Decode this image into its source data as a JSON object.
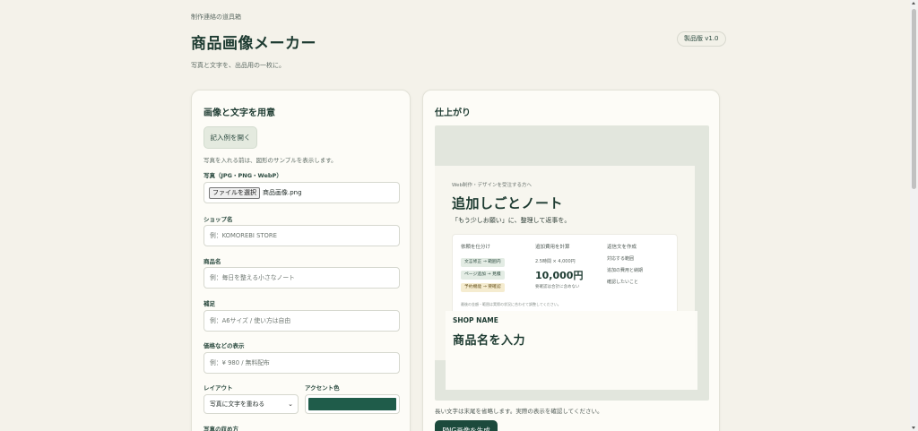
{
  "header": {
    "eyebrow": "制作連絡の道具箱",
    "title": "商品画像メーカー",
    "subtitle": "写真と文字を、出品用の一枚に。",
    "version_badge": "製品版 v1.0"
  },
  "form_panel": {
    "title": "画像と文字を用意",
    "sample_button": "記入例を開く",
    "hint": "写真を入れる前は、図形のサンプルを表示します。",
    "photo": {
      "label": "写真（JPG・PNG・WebP）",
      "button": "ファイルを選択",
      "file_name": "商品画像.png"
    },
    "shop": {
      "label": "ショップ名",
      "placeholder": "例：KOMOREBI STORE"
    },
    "product": {
      "label": "商品名",
      "placeholder": "例：毎日を整える小さなノート"
    },
    "note": {
      "label": "補足",
      "placeholder": "例：A6サイズ / 使い方は自由"
    },
    "price": {
      "label": "価格などの表示",
      "placeholder": "例：¥ 980 / 無料配布"
    },
    "layout": {
      "label": "レイアウト",
      "value": "写真に文字を重ねる"
    },
    "accent": {
      "label": "アクセント色",
      "color": "#1f5c4a"
    },
    "fit_label": "写真の収め方"
  },
  "preview_panel": {
    "title": "仕上がり",
    "sample_image": {
      "eyebrow": "Web制作・デザインを受注する方へ",
      "title": "追加しごとノート",
      "subtitle": "「もう少しお願い」に、整理して返事を。",
      "col1": {
        "heading": "依頼を仕分け",
        "tags": [
          "文言修正 → 範囲内",
          "ページ追加 → 見積",
          "予約機能 → 要確認"
        ]
      },
      "col2": {
        "heading": "追加費用を計算",
        "formula": "2.5時間 × 4,000円",
        "amount": "10,000円",
        "note": "要確認は合計に含めない"
      },
      "col3": {
        "heading": "返信文を作成",
        "items": [
          "対応する範囲",
          "追加の費用と納期",
          "確認したいこと"
        ]
      },
      "footnote": "最後の金額・範囲は実際の状況に合わせて調整してください。"
    },
    "overlay": {
      "shop_name": "SHOP NAME",
      "product_name": "商品名を入力"
    },
    "note": "長い文字は末尾を省略します。実際の表示を確認してください。",
    "generate_button": "PNG画像を生成"
  },
  "colors": {
    "accent": "#1f5c4a",
    "background": "#f4f2ea",
    "button": "#1c4a3c"
  }
}
